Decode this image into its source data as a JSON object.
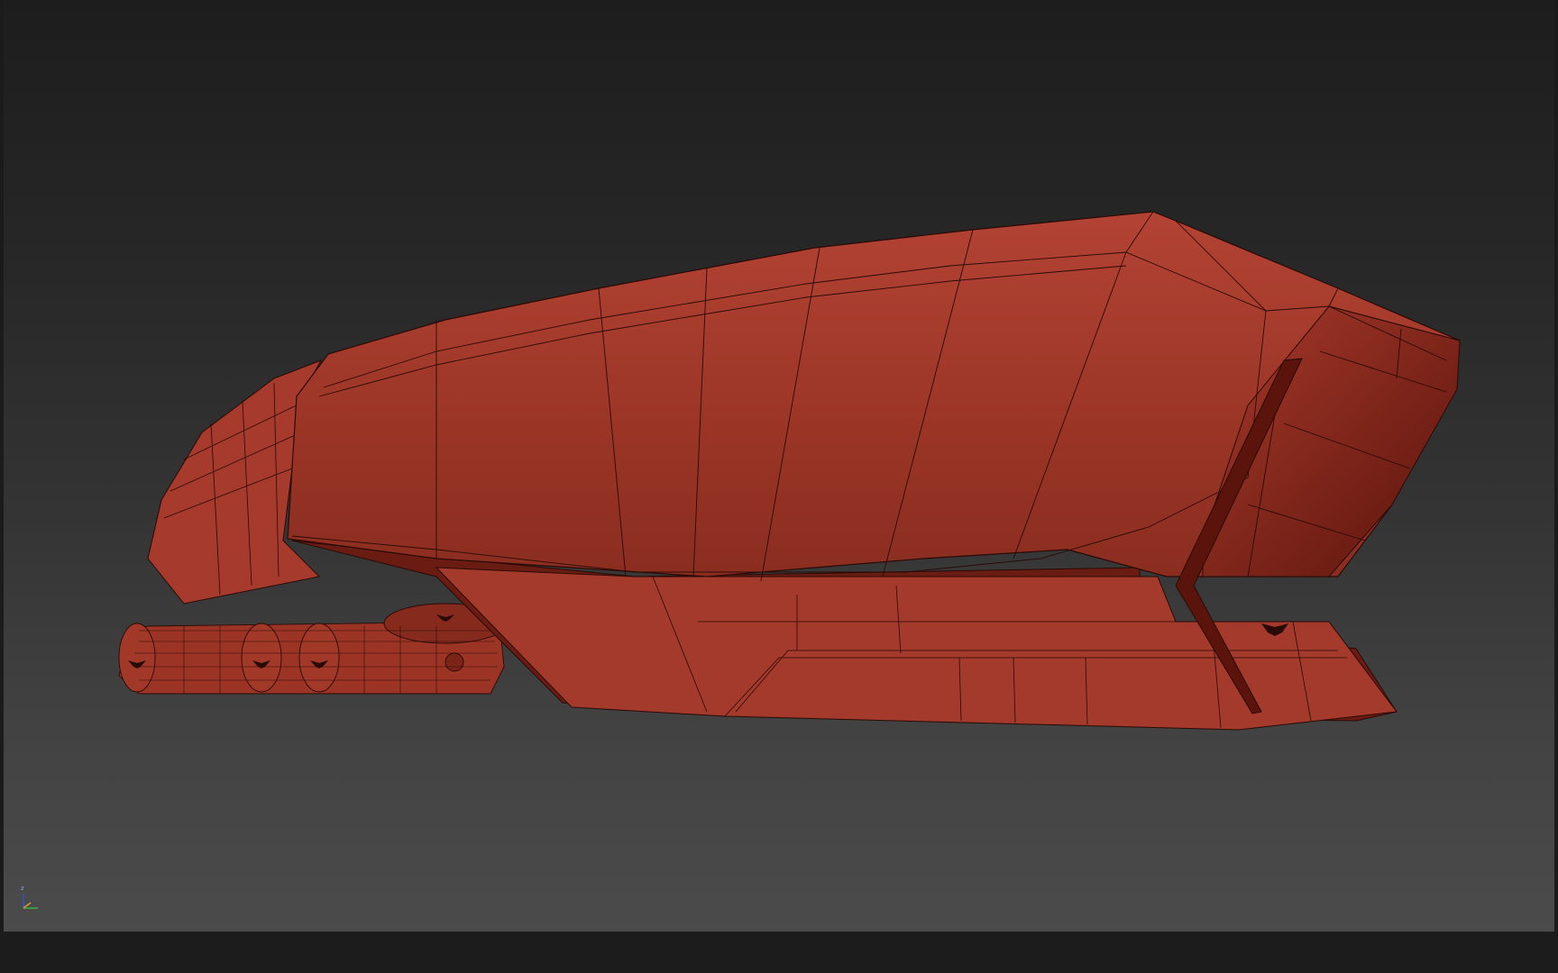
{
  "viewport": {
    "shading": "shaded-wireframe",
    "background_top": "#1d1d1d",
    "background_bottom": "#4b4b4b"
  },
  "model": {
    "fill_color": "#a33a2c",
    "shadow_color": "#6a1c12",
    "highlight_color": "#c0544a",
    "wire_color": "#2a0a06",
    "emblem_icon": "winged-emblem-icon"
  },
  "axis_gizmo": {
    "z_label": "z",
    "colors": {
      "x": "#3fae3f",
      "y": "#d6a02e",
      "z": "#3c4fd0"
    }
  }
}
